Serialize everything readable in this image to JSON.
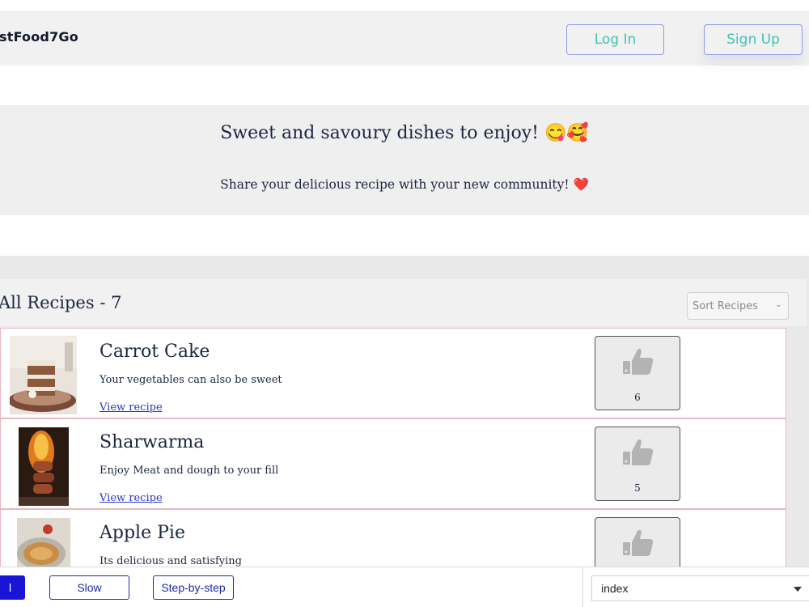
{
  "navbar": {
    "brand": "stFood7Go",
    "login_label": "Log In",
    "signup_label": "Sign Up"
  },
  "hero": {
    "title": "Sweet and savoury dishes to enjoy! 😋🥰",
    "subtitle": "Share your delicious recipe with your new community! ❤️"
  },
  "recipes": {
    "heading": "All Recipes - 7",
    "sort_placeholder": "Sort Recipes",
    "view_label": "View recipe",
    "items": [
      {
        "title": "Carrot Cake",
        "description": "Your vegetables can also be sweet",
        "likes": "6",
        "image": "carrot-cake-photo"
      },
      {
        "title": "Sharwarma",
        "description": "Enjoy Meat and dough to your fill",
        "likes": "5",
        "image": "sharwarma-photo"
      },
      {
        "title": "Apple Pie",
        "description": "Its delicious and satisfying",
        "likes": "",
        "image": "apple-pie-photo"
      }
    ]
  },
  "controls": {
    "active_label": "l",
    "slow_label": "Slow",
    "step_label": "Step-by-step",
    "index_value": "index"
  },
  "colors": {
    "accent_text": "#3fc6b2",
    "button_border": "#8e9be8",
    "card_border": "#e8b9bf",
    "link": "#2a35c9",
    "control_blue": "#1a14d6"
  }
}
